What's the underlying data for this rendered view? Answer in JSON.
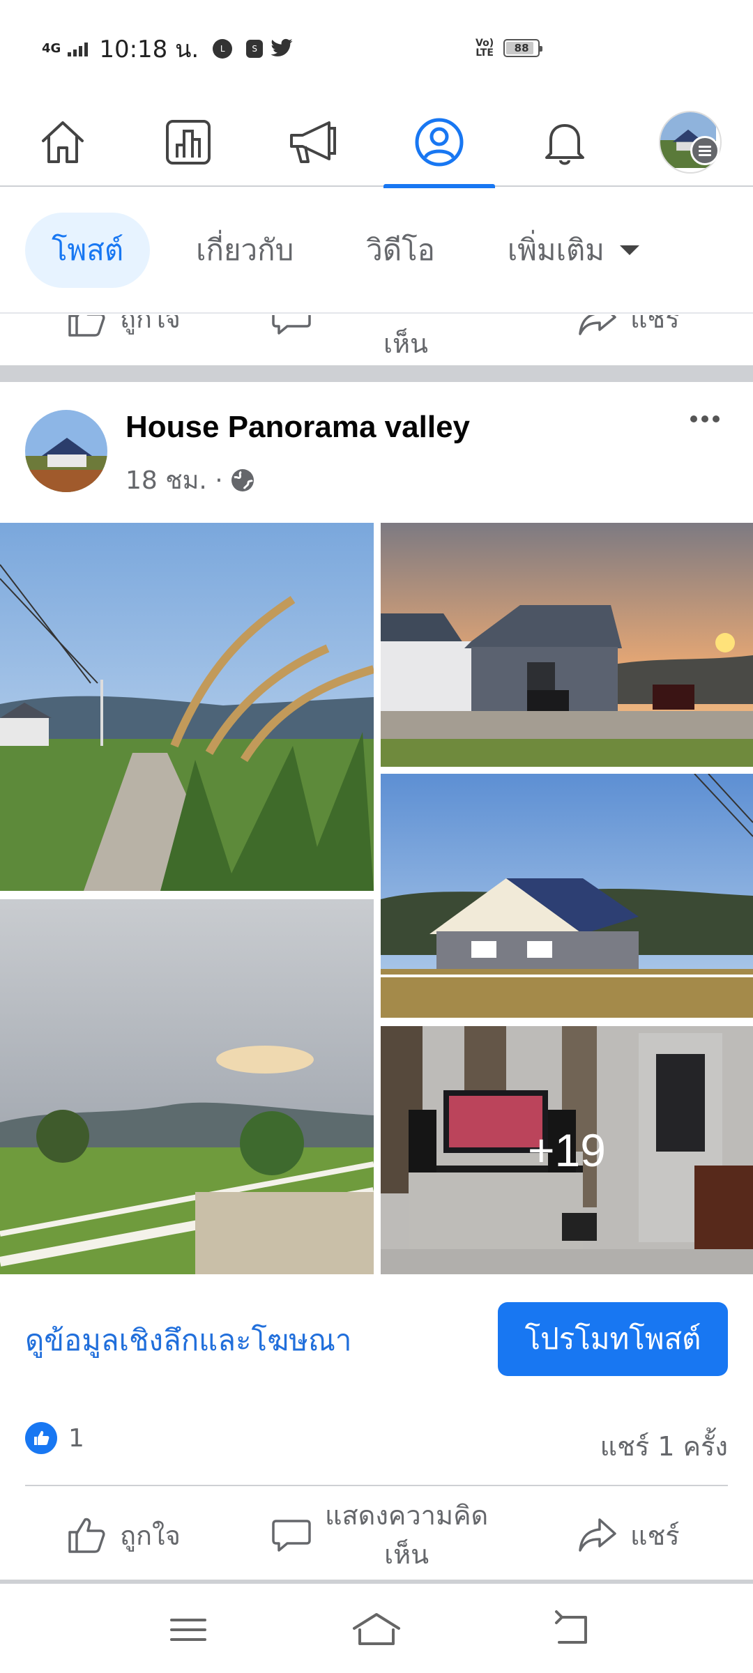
{
  "status_bar": {
    "network": "4G",
    "time": "10:18 น.",
    "apps": [
      "LINE",
      "S",
      "twitter"
    ],
    "volte": "VoLTE",
    "battery": "88",
    "battery_level": 0.88
  },
  "top_nav": {
    "items": [
      "home",
      "pages",
      "ads",
      "profile",
      "notifications",
      "account"
    ],
    "active": "profile"
  },
  "sub_tabs": {
    "items": [
      "โพสต์",
      "เกี่ยวกับ",
      "วิดีโอ",
      "เพิ่มเติม"
    ],
    "active_index": 0
  },
  "previous_actions": {
    "like": "ถูกใจ",
    "comment": "เห็น",
    "share": "แชร์"
  },
  "post": {
    "author": "House Panorama valley",
    "time": "18 ชม. ·",
    "privacy_icon": "globe-icon",
    "more_photos": "+19",
    "insights_link": "ดูข้อมูลเชิงลึกและโฆษณา",
    "promote_button": "โปรโมทโพสต์",
    "like_count": "1",
    "share_count": "แชร์ 1 ครั้ง",
    "actions": {
      "like": "ถูกใจ",
      "comment_line1": "แสดงความคิด",
      "comment_line2": "เห็น",
      "share": "แชร์"
    }
  },
  "colors": {
    "accent": "#1877f2",
    "link": "#216fdb",
    "secondary_text": "#65676b",
    "divider": "#ced0d4"
  }
}
